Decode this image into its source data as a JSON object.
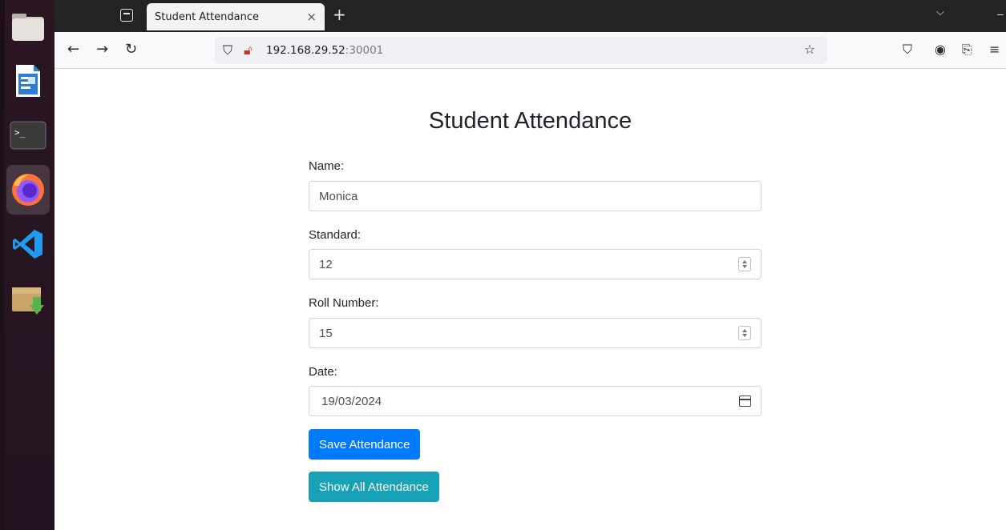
{
  "browser": {
    "tab_title": "Student Attendance",
    "tab_close": "×",
    "new_tab": "+",
    "url_host": "192.168.29.52",
    "url_port": ":30001"
  },
  "dock": {
    "items": [
      {
        "name": "files-icon"
      },
      {
        "name": "libreoffice-writer-icon"
      },
      {
        "name": "terminal-icon"
      },
      {
        "name": "firefox-icon",
        "active": true
      },
      {
        "name": "vscode-icon"
      },
      {
        "name": "software-installer-icon"
      }
    ]
  },
  "page": {
    "title": "Student Attendance",
    "form": {
      "name_label": "Name:",
      "name_value": "Monica",
      "standard_label": "Standard:",
      "standard_value": "12",
      "roll_label": "Roll Number:",
      "roll_value": "15",
      "date_label": "Date:",
      "date_value": "19/03/2024"
    },
    "buttons": {
      "save": "Save Attendance",
      "show_all": "Show All Attendance"
    }
  },
  "colors": {
    "primary": "#007bff",
    "info": "#17a2b8",
    "dock_bg": "#2b1622",
    "close_button": "#e95420"
  }
}
